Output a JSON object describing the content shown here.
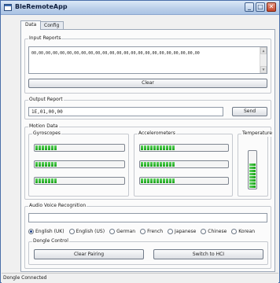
{
  "window": {
    "title": "BleRemoteApp",
    "controls": {
      "minimize": "_",
      "maximize": "□",
      "close": "✕"
    }
  },
  "tabs": [
    {
      "label": "Data",
      "active": true
    },
    {
      "label": "Config",
      "active": false
    }
  ],
  "input_reports": {
    "title": "Input Reports",
    "text": "00,00,00,00,00,00,00,00,00,00,00,00,00,00,00,00,00,00,00,00,00,00,00,00",
    "clear_label": "Clear"
  },
  "output_report": {
    "title": "Output Report",
    "value": "1E,01,00,00",
    "send_label": "Send"
  },
  "motion_data": {
    "title": "Motion Data",
    "gyroscopes": {
      "title": "Gyroscopes",
      "levels": [
        0.25,
        0.25,
        0.25
      ]
    },
    "accelerometers": {
      "title": "Accelerometers",
      "levels": [
        0.4,
        0.4,
        0.4
      ]
    },
    "temperature": {
      "title": "Temperature",
      "level": 0.7
    },
    "bar_color": "#22b422"
  },
  "audio": {
    "title": "Audio Voice Recognition",
    "text_value": "",
    "languages": [
      {
        "label": "English (UK)",
        "checked": true
      },
      {
        "label": "English (US)",
        "checked": false
      },
      {
        "label": "German",
        "checked": false
      },
      {
        "label": "French",
        "checked": false
      },
      {
        "label": "Japanese",
        "checked": false
      },
      {
        "label": "Chinese",
        "checked": false
      },
      {
        "label": "Korean",
        "checked": false
      }
    ]
  },
  "dongle_control": {
    "title": "Dongle Control",
    "clear_pairing_label": "Clear Pairing",
    "switch_label": "Switch to HCI"
  },
  "status": {
    "text": "Dongle Connected"
  }
}
